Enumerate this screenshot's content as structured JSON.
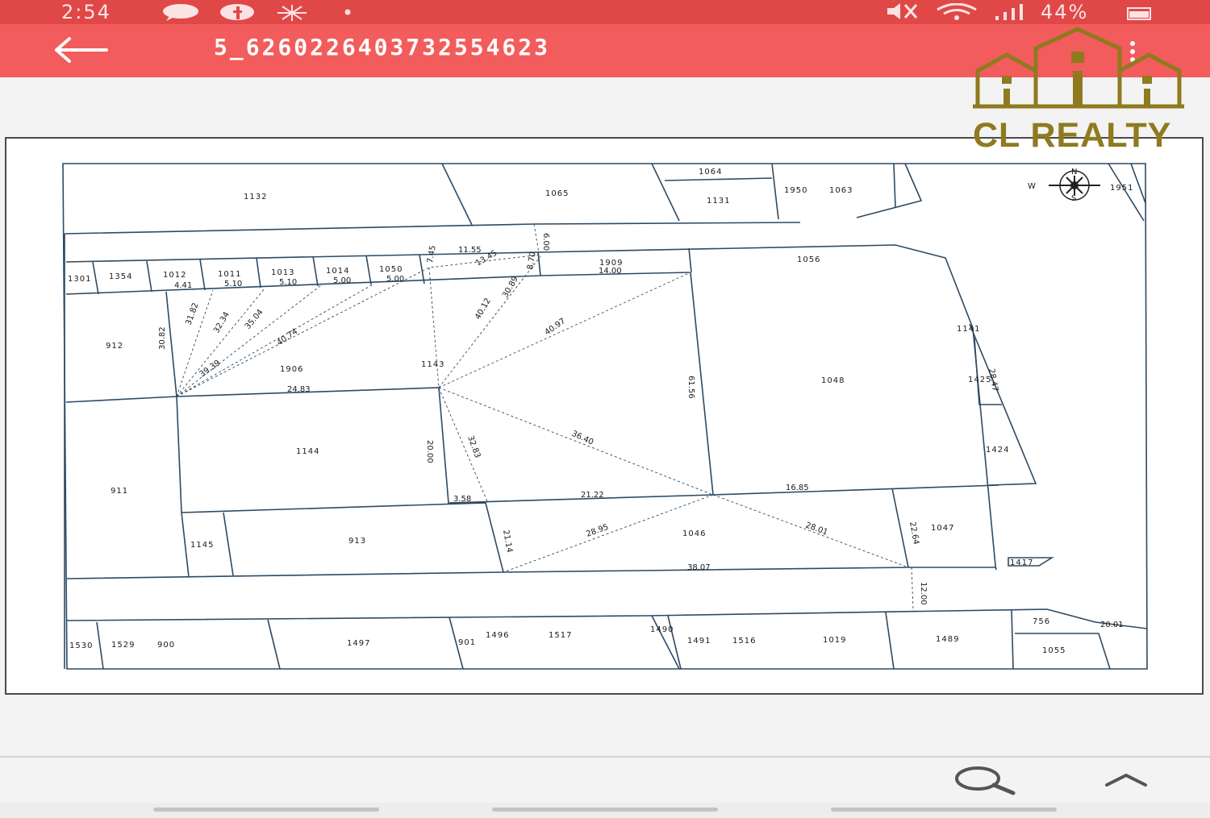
{
  "status_bar": {
    "time": "2:54",
    "battery": "44%",
    "icons": [
      "chat-bubble-icon",
      "facebook-icon",
      "cloud-icon",
      "dot-icon",
      "mute-icon",
      "wifi-icon",
      "signal-icon",
      "battery-icon"
    ]
  },
  "app_bar": {
    "title": "5_6260226403732554623",
    "back_icon": "arrow-left-icon",
    "more_icon": "more-vertical-icon",
    "color": "#f25c5c"
  },
  "logo": {
    "text": "CL REALTY",
    "color": "#8f7a1e"
  },
  "plan": {
    "compass": {
      "n": "N",
      "s": "S",
      "w": "W"
    },
    "lots": {
      "l1132": "1132",
      "l1065": "1065",
      "l1064": "1064",
      "l1131": "1131",
      "l1950": "1950",
      "l1063": "1063",
      "l1951": "1951",
      "l1301": "1301",
      "l1354": "1354",
      "l1012": "1012",
      "l1011": "1011",
      "l1013": "1013",
      "l1014": "1014",
      "l1050": "1050",
      "l1909": "1909",
      "l1056": "1056",
      "l912": "912",
      "l1906": "1906",
      "l1143": "1143",
      "l1048": "1048",
      "l1141": "1141",
      "l1425": "1425",
      "l1424": "1424",
      "l911": "911",
      "l1144": "1144",
      "l1145": "1145",
      "l913": "913",
      "l1046": "1046",
      "l1047": "1047",
      "l1417": "1417",
      "l1530": "1530",
      "l1529": "1529",
      "l900": "900",
      "l1497": "1497",
      "l901": "901",
      "l1496": "1496",
      "l1517": "1517",
      "l1490": "1490",
      "l1491": "1491",
      "l1516": "1516",
      "l1019": "1019",
      "l1489": "1489",
      "l756": "756",
      "l1055": "1055"
    },
    "dims": {
      "d1155": "11.55",
      "d600": "6.00",
      "d441": "4.41",
      "d510a": "5.10",
      "d510b": "5.10",
      "d500a": "5.00",
      "d500b": "5.00",
      "d1400": "14.00",
      "d1345": "13.45",
      "d745": "7.45",
      "d870": "8.70",
      "d3082": "30.82",
      "d3182": "31.82",
      "d3234": "32.34",
      "d3504": "35.04",
      "d4074": "40.74",
      "d3939": "39.39",
      "d4012": "40.12",
      "d4097": "40.97",
      "d3089": "30.89",
      "d2483": "24.83",
      "d6156": "61.56",
      "d2000": "20.00",
      "d3283": "32.83",
      "d3640": "36.40",
      "d358": "3.58",
      "d2122": "21.22",
      "d1685": "16.85",
      "d2114": "21.14",
      "d2895": "28.95",
      "d2801": "28.01",
      "d2264": "22.64",
      "d3807": "38.07",
      "d1200": "12.00",
      "d2001": "20.01",
      "d2847": "28.47"
    }
  },
  "bottom_bar": {
    "search_icon": "search-icon",
    "up_icon": "chevron-up-icon"
  }
}
